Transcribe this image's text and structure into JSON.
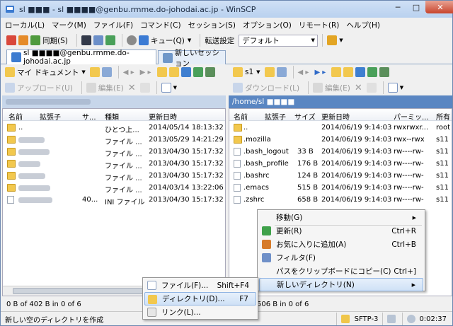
{
  "window": {
    "title": "sl ■■■ - sl ■■■■@genbu.rmme.do-johodai.ac.jp - WinSCP",
    "controls": {
      "minimize": "─",
      "maximize": "□",
      "close": "✕"
    }
  },
  "menubar": [
    "ローカル(L)",
    "マーク(M)",
    "ファイル(F)",
    "コマンド(C)",
    "セッション(S)",
    "オプション(O)",
    "リモート(R)",
    "ヘルプ(H)"
  ],
  "toolbar": {
    "sync_label": "同期(S)",
    "queue_label": "キュー(Q)",
    "transfer_settings_label": "転送設定",
    "transfer_settings_value": "デフォルト"
  },
  "tabs": [
    {
      "label": "sl ■■■■@genbu.rmme.do-johodai.ac.jp"
    },
    {
      "label": "新しいセッション"
    }
  ],
  "left_panel": {
    "location": "マイ ドキュメント",
    "upload_label": "アップロード(U)",
    "edit_label": "編集(E)",
    "headers": {
      "name": "名前",
      "ext": "拡張子",
      "size": "サ...",
      "type": "種類",
      "modified": "更新日時"
    },
    "rows": [
      {
        "name": "..",
        "size": "",
        "type": "ひとつ上...",
        "modified": "2014/05/14  18:13:32",
        "kind": "up"
      },
      {
        "name": "",
        "size": "",
        "type": "ファイル ...",
        "modified": "2013/05/29  14:21:29",
        "kind": "folder"
      },
      {
        "name": "",
        "size": "",
        "type": "ファイル ...",
        "modified": "2013/04/30  15:17:32",
        "kind": "folder"
      },
      {
        "name": "",
        "size": "",
        "type": "ファイル ...",
        "modified": "2013/04/30  15:17:32",
        "kind": "folder"
      },
      {
        "name": "",
        "size": "",
        "type": "ファイル ...",
        "modified": "2013/04/30  15:17:32",
        "kind": "folder"
      },
      {
        "name": "",
        "size": "",
        "type": "ファイル ...",
        "modified": "2014/03/14  13:22:06",
        "kind": "folder"
      },
      {
        "name": "",
        "size": "40...",
        "type": "INI ファイル",
        "modified": "2013/04/30  15:17:32",
        "kind": "file"
      }
    ],
    "status": "0 B of 402 B in 0 of 6"
  },
  "right_panel": {
    "location": "s1",
    "path": "/home/sl ■■■■",
    "download_label": "ダウンロード(L)",
    "edit_label": "編集(E)",
    "headers": {
      "name": "名前",
      "ext": "拡張子",
      "size": "サイズ",
      "modified": "更新日時",
      "perm": "パーミッ...",
      "owner": "所有"
    },
    "rows": [
      {
        "name": "..",
        "size": "",
        "modified": "2014/06/19 9:14:03",
        "perm": "rwxrwxr...",
        "owner": "root",
        "kind": "up"
      },
      {
        "name": ".mozilla",
        "size": "",
        "modified": "2014/06/19 9:14:03",
        "perm": "rwx--rwx",
        "owner": "s11",
        "kind": "folder"
      },
      {
        "name": ".bash_logout",
        "size": "33 B",
        "modified": "2014/06/19 9:14:03",
        "perm": "rw----rw-",
        "owner": "s11",
        "kind": "file"
      },
      {
        "name": ".bash_profile",
        "size": "176 B",
        "modified": "2014/06/19 9:14:03",
        "perm": "rw----rw-",
        "owner": "s11",
        "kind": "file"
      },
      {
        "name": ".bashrc",
        "size": "124 B",
        "modified": "2014/06/19 9:14:03",
        "perm": "rw----rw-",
        "owner": "s11",
        "kind": "file"
      },
      {
        "name": ".emacs",
        "size": "515 B",
        "modified": "2014/06/19 9:14:03",
        "perm": "rw----rw-",
        "owner": "s11",
        "kind": "file"
      },
      {
        "name": ".zshrc",
        "size": "658 B",
        "modified": "2014/06/19 9:14:03",
        "perm": "rw----rw-",
        "owner": "s11",
        "kind": "file"
      }
    ],
    "status": "506 B in 0 of 6"
  },
  "context_menu": {
    "items": [
      {
        "label": "移動(G)",
        "key": "▶",
        "icon": ""
      },
      {
        "label": "更新(R)",
        "key": "Ctrl+R",
        "icon": "refresh-icon"
      },
      {
        "label": "お気に入りに追加(A)",
        "key": "Ctrl+B",
        "icon": "bookmark-icon"
      },
      {
        "label": "フィルタ(F)",
        "key": "",
        "icon": "filter-icon"
      },
      {
        "label": "パスをクリップボードにコピー(C)",
        "key": "Ctrl+]",
        "icon": ""
      },
      {
        "label": "新しいディレクトリ(N)",
        "key": "▶",
        "icon": ""
      }
    ]
  },
  "submenu": {
    "items": [
      {
        "label": "ファイル(F)...",
        "key": "Shift+F4",
        "icon": "new-file-icon"
      },
      {
        "label": "ディレクトリ(D)...",
        "key": "F7",
        "icon": "new-folder-icon"
      },
      {
        "label": "リンク(L)...",
        "key": "",
        "icon": "link-icon"
      }
    ]
  },
  "statusbar": {
    "hint": "新しい空のディレクトリを作成",
    "protocol": "SFTP-3",
    "elapsed": "0:02:37"
  },
  "colors": {
    "accent": "#5a86c2",
    "folder": "#f2c84e",
    "highlight": "#cfe1f6"
  }
}
